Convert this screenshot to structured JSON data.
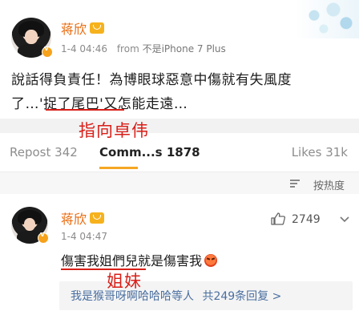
{
  "post": {
    "username": "蒋欣",
    "timestamp": "1-4 04:46",
    "source_prefix": "from",
    "source": "不是iPhone 7 Plus",
    "text_line1": "說話得負責任！為博眼球惡意中傷就有失風度",
    "text_line2": "了…'捉了尾巴'又怎能走遠…",
    "annotation": "指向卓伟"
  },
  "stats": {
    "repost_label": "Repost",
    "repost_count": "342",
    "comments_label": "Comm...s",
    "comments_count": "1878",
    "likes_label": "Likes",
    "likes_count": "31k"
  },
  "sort": {
    "label": "按热度"
  },
  "comment": {
    "username": "蒋欣",
    "timestamp": "1-4 04:47",
    "text": "傷害我姐們兒就是傷害我",
    "like_count": "2749",
    "annotation": "姐妹",
    "reply_preview": "我是猴哥呀啊哈哈哈等人",
    "reply_count": "共249条回复 >"
  },
  "colors": {
    "username": "#e86b0f",
    "annotation_red": "#d91e18",
    "tab_indicator": "#f5a623",
    "reply_link": "#4a6fa0"
  }
}
